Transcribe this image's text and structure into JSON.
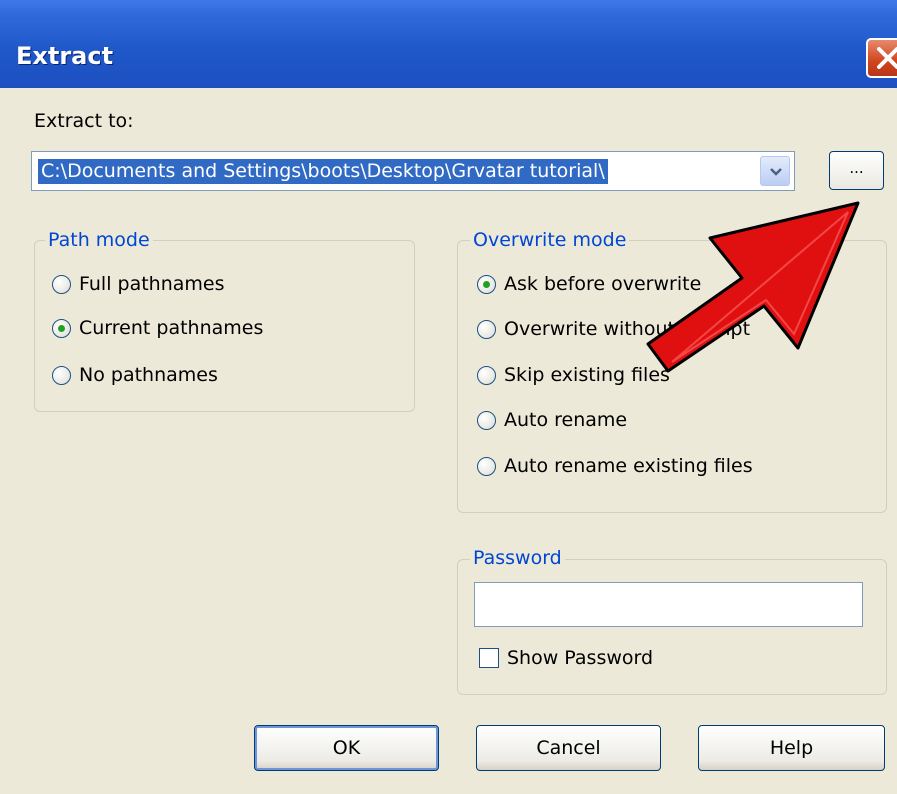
{
  "window": {
    "title": "Extract"
  },
  "extract_to": {
    "label": "Extract to:",
    "path": "C:\\Documents and Settings\\boots\\Desktop\\Grvatar tutorial\\",
    "browse_label": "..."
  },
  "path_mode": {
    "legend": "Path mode",
    "options": [
      "Full pathnames",
      "Current pathnames",
      "No pathnames"
    ],
    "selected": "Current pathnames"
  },
  "overwrite_mode": {
    "legend": "Overwrite mode",
    "options": [
      "Ask before overwrite",
      "Overwrite without prompt",
      "Skip existing files",
      "Auto rename",
      "Auto rename existing files"
    ],
    "selected": "Ask before overwrite"
  },
  "password": {
    "legend": "Password",
    "value": "",
    "show_password_label": "Show Password",
    "show_password_checked": false
  },
  "buttons": {
    "ok": "OK",
    "cancel": "Cancel",
    "help": "Help"
  },
  "colors": {
    "title_bar": "#2e66d8",
    "selection": "#316ac5",
    "legend_text": "#0046d5",
    "annotation_arrow": "#e01010"
  }
}
